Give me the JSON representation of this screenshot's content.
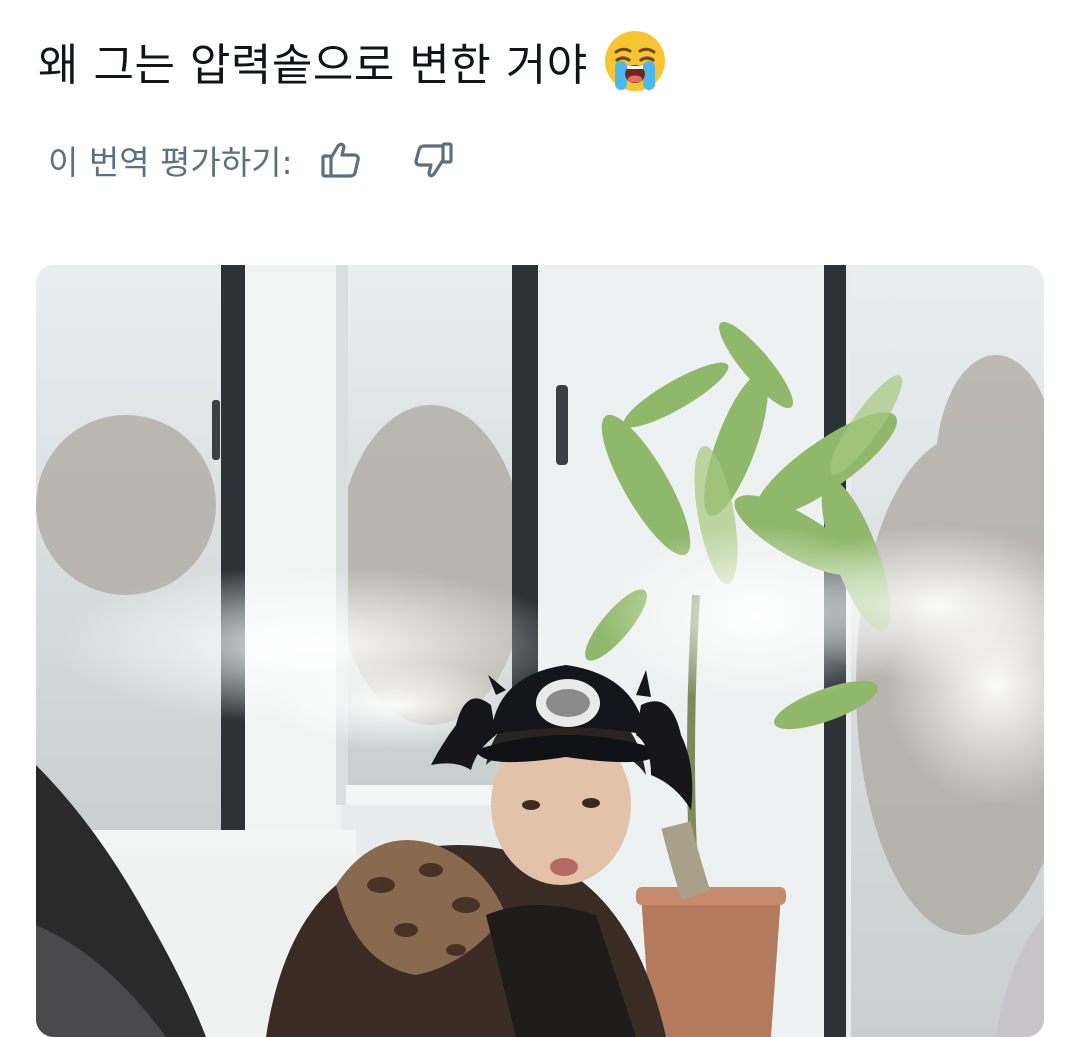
{
  "post": {
    "text": "왜 그는 압력솥으로 변한 거야",
    "emoji_icon": "loudly-crying-face-emoji"
  },
  "translation_rating": {
    "label": "이 번역 평가하기:",
    "thumbs_up_icon": "thumbs-up-icon",
    "thumbs_down_icon": "thumbs-down-icon",
    "icon_color": "#5b7083"
  },
  "media": {
    "type": "photo",
    "subject": "person in bat-wing cap with steam jets from ears, indoor by windows with potted plant"
  },
  "colors": {
    "text": "#111418",
    "secondary": "#5b7083",
    "background": "#ffffff"
  }
}
